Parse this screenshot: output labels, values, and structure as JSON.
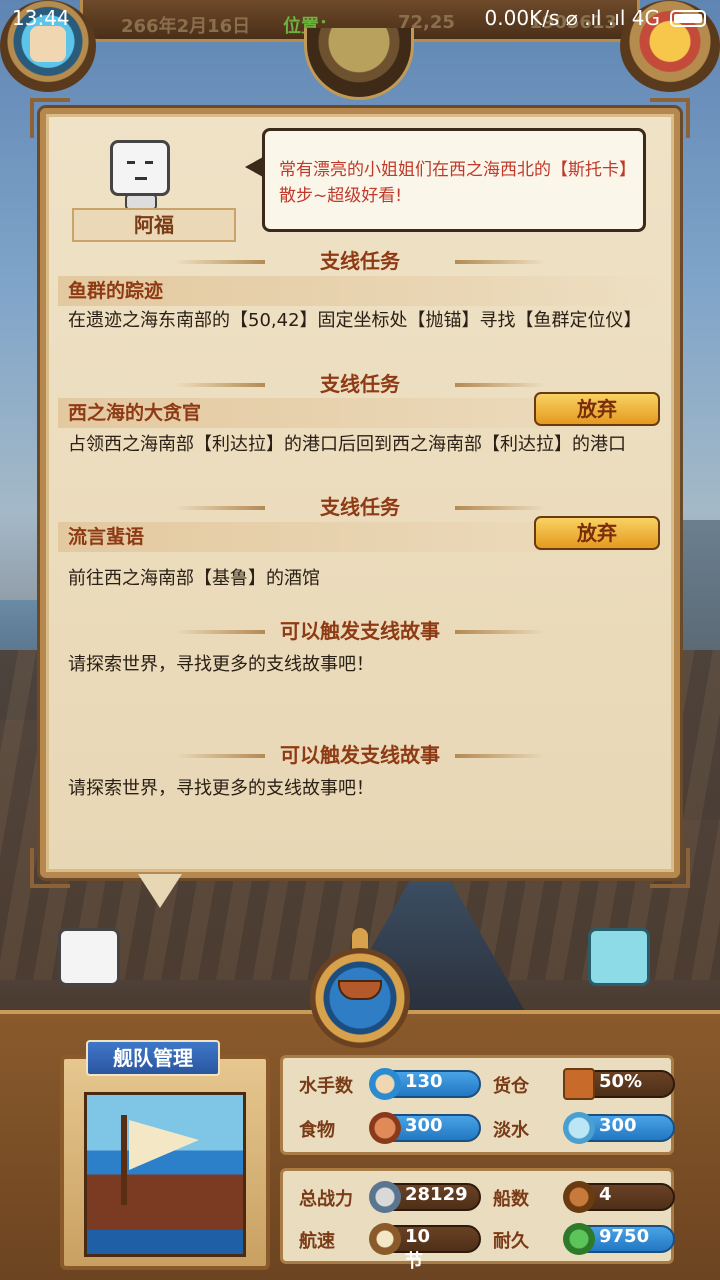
{
  "status_bar": {
    "time": "13:44",
    "network": "0.00K/s ⌀ .ıl .ıl 4G"
  },
  "top_bar": {
    "date": "266年2月16日",
    "position_label": "位置：",
    "position_value": "72,25",
    "gold": "1905613"
  },
  "npc": {
    "name": "阿福",
    "dialogue": "常有漂亮的小姐姐们在西之海西北的【斯托卡】散步~超级好看!"
  },
  "quests": [
    {
      "header": "支线任务",
      "title": "鱼群的踪迹",
      "description": "在遗迹之海东南部的【50,42】固定坐标处【抛锚】寻找【鱼群定位仪】",
      "has_abandon": false
    },
    {
      "header": "支线任务",
      "title": "西之海的大贪官",
      "description": "占领西之海南部【利达拉】的港口后回到西之海南部【利达拉】的港口",
      "has_abandon": true
    },
    {
      "header": "支线任务",
      "title": "流言蜚语",
      "description": "前往西之海南部【基鲁】的酒馆",
      "has_abandon": true
    }
  ],
  "abandon_label": "放弃",
  "story_slots": [
    {
      "header": "可以触发支线故事",
      "description": "请探索世界，寻找更多的支线故事吧！"
    },
    {
      "header": "可以触发支线故事",
      "description": "请探索世界，寻找更多的支线故事吧！"
    }
  ],
  "fleet": {
    "title": "舰队管理",
    "stats": {
      "sailors": {
        "label": "水手数",
        "value": "130",
        "icon": "sailor-icon"
      },
      "cargo": {
        "label": "货仓",
        "value": "50%",
        "icon": "cargo-icon"
      },
      "food": {
        "label": "食物",
        "value": "300",
        "icon": "food-icon"
      },
      "water": {
        "label": "淡水",
        "value": "300",
        "icon": "water-icon"
      },
      "power": {
        "label": "总战力",
        "value": "28129",
        "icon": "crossed-swords-icon"
      },
      "ships": {
        "label": "船数",
        "value": "4",
        "icon": "ship-icon"
      },
      "speed": {
        "label": "航速",
        "value": "10节",
        "icon": "sail-icon"
      },
      "durability": {
        "label": "耐久",
        "value": "9750",
        "icon": "hull-icon"
      }
    }
  },
  "colors": {
    "parchment": "#ead8b6",
    "accent_red": "#c0392b",
    "title_brown": "#8e3a14",
    "button_gold": "#f0b840",
    "stat_blue": "#2a7fc9"
  }
}
